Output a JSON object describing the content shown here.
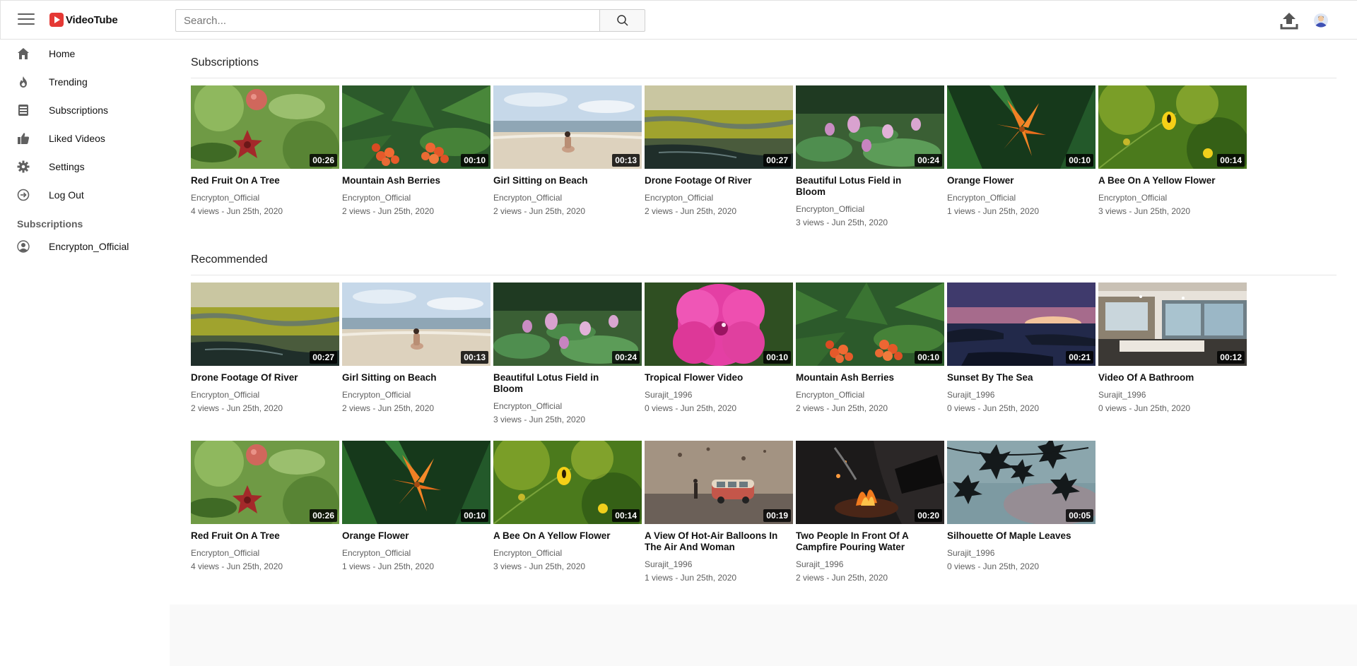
{
  "header": {
    "logo_text": "VideoTube",
    "search_placeholder": "Search..."
  },
  "sidebar": {
    "items": [
      {
        "label": "Home",
        "icon": "home-icon"
      },
      {
        "label": "Trending",
        "icon": "fire-icon"
      },
      {
        "label": "Subscriptions",
        "icon": "subscriptions-icon"
      },
      {
        "label": "Liked Videos",
        "icon": "thumbs-up-icon"
      },
      {
        "label": "Settings",
        "icon": "gear-icon"
      },
      {
        "label": "Log Out",
        "icon": "logout-icon"
      }
    ],
    "subscriptions_heading": "Subscriptions",
    "channels": [
      {
        "label": "Encrypton_Official",
        "icon": "user-circle-icon"
      }
    ]
  },
  "sections": {
    "subscriptions_title": "Subscriptions",
    "recommended_title": "Recommended"
  },
  "subscriptions": [
    {
      "title": "Red Fruit On A Tree",
      "duration": "00:26",
      "channel": "Encrypton_Official",
      "meta": "4 views - Jun 25th, 2020",
      "thumb": "fruit"
    },
    {
      "title": "Mountain Ash Berries",
      "duration": "00:10",
      "channel": "Encrypton_Official",
      "meta": "2 views - Jun 25th, 2020",
      "thumb": "berries"
    },
    {
      "title": "Girl Sitting on Beach",
      "duration": "00:13",
      "channel": "Encrypton_Official",
      "meta": "2 views - Jun 25th, 2020",
      "thumb": "beach"
    },
    {
      "title": "Drone Footage Of River",
      "duration": "00:27",
      "channel": "Encrypton_Official",
      "meta": "2 views - Jun 25th, 2020",
      "thumb": "river"
    },
    {
      "title": "Beautiful Lotus Field in Bloom",
      "duration": "00:24",
      "channel": "Encrypton_Official",
      "meta": "3 views - Jun 25th, 2020",
      "thumb": "lotus"
    },
    {
      "title": "Orange Flower",
      "duration": "00:10",
      "channel": "Encrypton_Official",
      "meta": "1 views - Jun 25th, 2020",
      "thumb": "lily"
    },
    {
      "title": "A Bee On A Yellow Flower",
      "duration": "00:14",
      "channel": "Encrypton_Official",
      "meta": "3 views - Jun 25th, 2020",
      "thumb": "bee"
    }
  ],
  "recommended": [
    {
      "title": "Drone Footage Of River",
      "duration": "00:27",
      "channel": "Encrypton_Official",
      "meta": "2 views - Jun 25th, 2020",
      "thumb": "river"
    },
    {
      "title": "Girl Sitting on Beach",
      "duration": "00:13",
      "channel": "Encrypton_Official",
      "meta": "2 views - Jun 25th, 2020",
      "thumb": "beach"
    },
    {
      "title": "Beautiful Lotus Field in Bloom",
      "duration": "00:24",
      "channel": "Encrypton_Official",
      "meta": "3 views - Jun 25th, 2020",
      "thumb": "lotus"
    },
    {
      "title": "Tropical Flower Video",
      "duration": "00:10",
      "channel": "Surajit_1996",
      "meta": "0 views - Jun 25th, 2020",
      "thumb": "hibiscus"
    },
    {
      "title": "Mountain Ash Berries",
      "duration": "00:10",
      "channel": "Encrypton_Official",
      "meta": "2 views - Jun 25th, 2020",
      "thumb": "berries"
    },
    {
      "title": "Sunset By The Sea",
      "duration": "00:21",
      "channel": "Surajit_1996",
      "meta": "0 views - Jun 25th, 2020",
      "thumb": "sunset"
    },
    {
      "title": "Video Of A Bathroom",
      "duration": "00:12",
      "channel": "Surajit_1996",
      "meta": "0 views - Jun 25th, 2020",
      "thumb": "bathroom"
    },
    {
      "title": "Red Fruit On A Tree",
      "duration": "00:26",
      "channel": "Encrypton_Official",
      "meta": "4 views - Jun 25th, 2020",
      "thumb": "fruit"
    },
    {
      "title": "Orange Flower",
      "duration": "00:10",
      "channel": "Encrypton_Official",
      "meta": "1 views - Jun 25th, 2020",
      "thumb": "lily"
    },
    {
      "title": "A Bee On A Yellow Flower",
      "duration": "00:14",
      "channel": "Encrypton_Official",
      "meta": "3 views - Jun 25th, 2020",
      "thumb": "bee"
    },
    {
      "title": "A View Of Hot-Air Balloons In The Air And Woman",
      "duration": "00:19",
      "channel": "Surajit_1996",
      "meta": "1 views - Jun 25th, 2020",
      "thumb": "van"
    },
    {
      "title": "Two People In Front Of A Campfire Pouring Water",
      "duration": "00:20",
      "channel": "Surajit_1996",
      "meta": "2 views - Jun 25th, 2020",
      "thumb": "campfire"
    },
    {
      "title": "Silhouette Of Maple Leaves",
      "duration": "00:05",
      "channel": "Surajit_1996",
      "meta": "0 views - Jun 25th, 2020",
      "thumb": "maple"
    }
  ],
  "colors": {
    "brand": "#e53935",
    "text_primary": "#111111",
    "text_secondary": "#606060",
    "icon_gray": "#606060"
  }
}
